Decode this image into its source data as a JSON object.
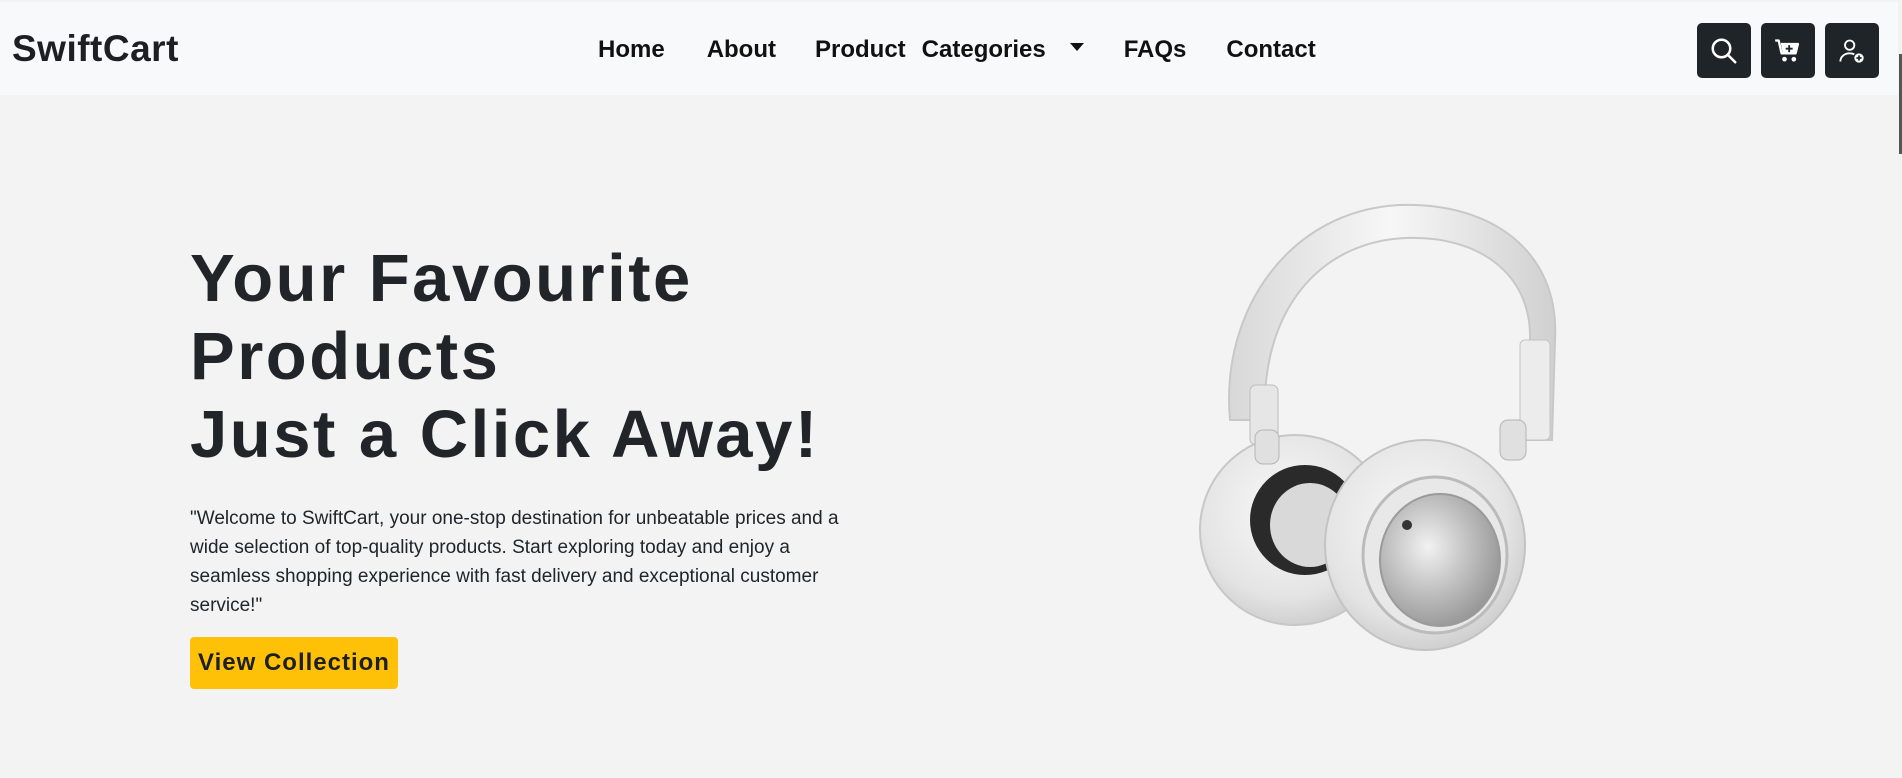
{
  "navbar": {
    "brand": "SwiftCart",
    "links": {
      "home": "Home",
      "about": "About",
      "product": "Product",
      "categories": "Categories",
      "faqs": "FAQs",
      "contact": "Contact"
    },
    "actions": {
      "search_icon": "search-icon",
      "cart_icon": "cart-add-icon",
      "user_icon": "user-add-icon"
    }
  },
  "hero": {
    "title_line1": "Your Favourite",
    "title_line2": "Products",
    "title_line3": "Just a Click Away!",
    "description": "\"Welcome to SwiftCart, your one-stop destination for unbeatable prices and a wide selection of top-quality products. Start exploring today and enjoy a seamless shopping experience with fast delivery and exceptional customer service!\"",
    "cta_label": "View Collection",
    "image": "headphones-image"
  },
  "colors": {
    "accent": "#ffc107",
    "icon_button_bg": "#1f2428",
    "navbar_bg": "#f8f9fa",
    "page_bg": "#f3f3f3"
  }
}
